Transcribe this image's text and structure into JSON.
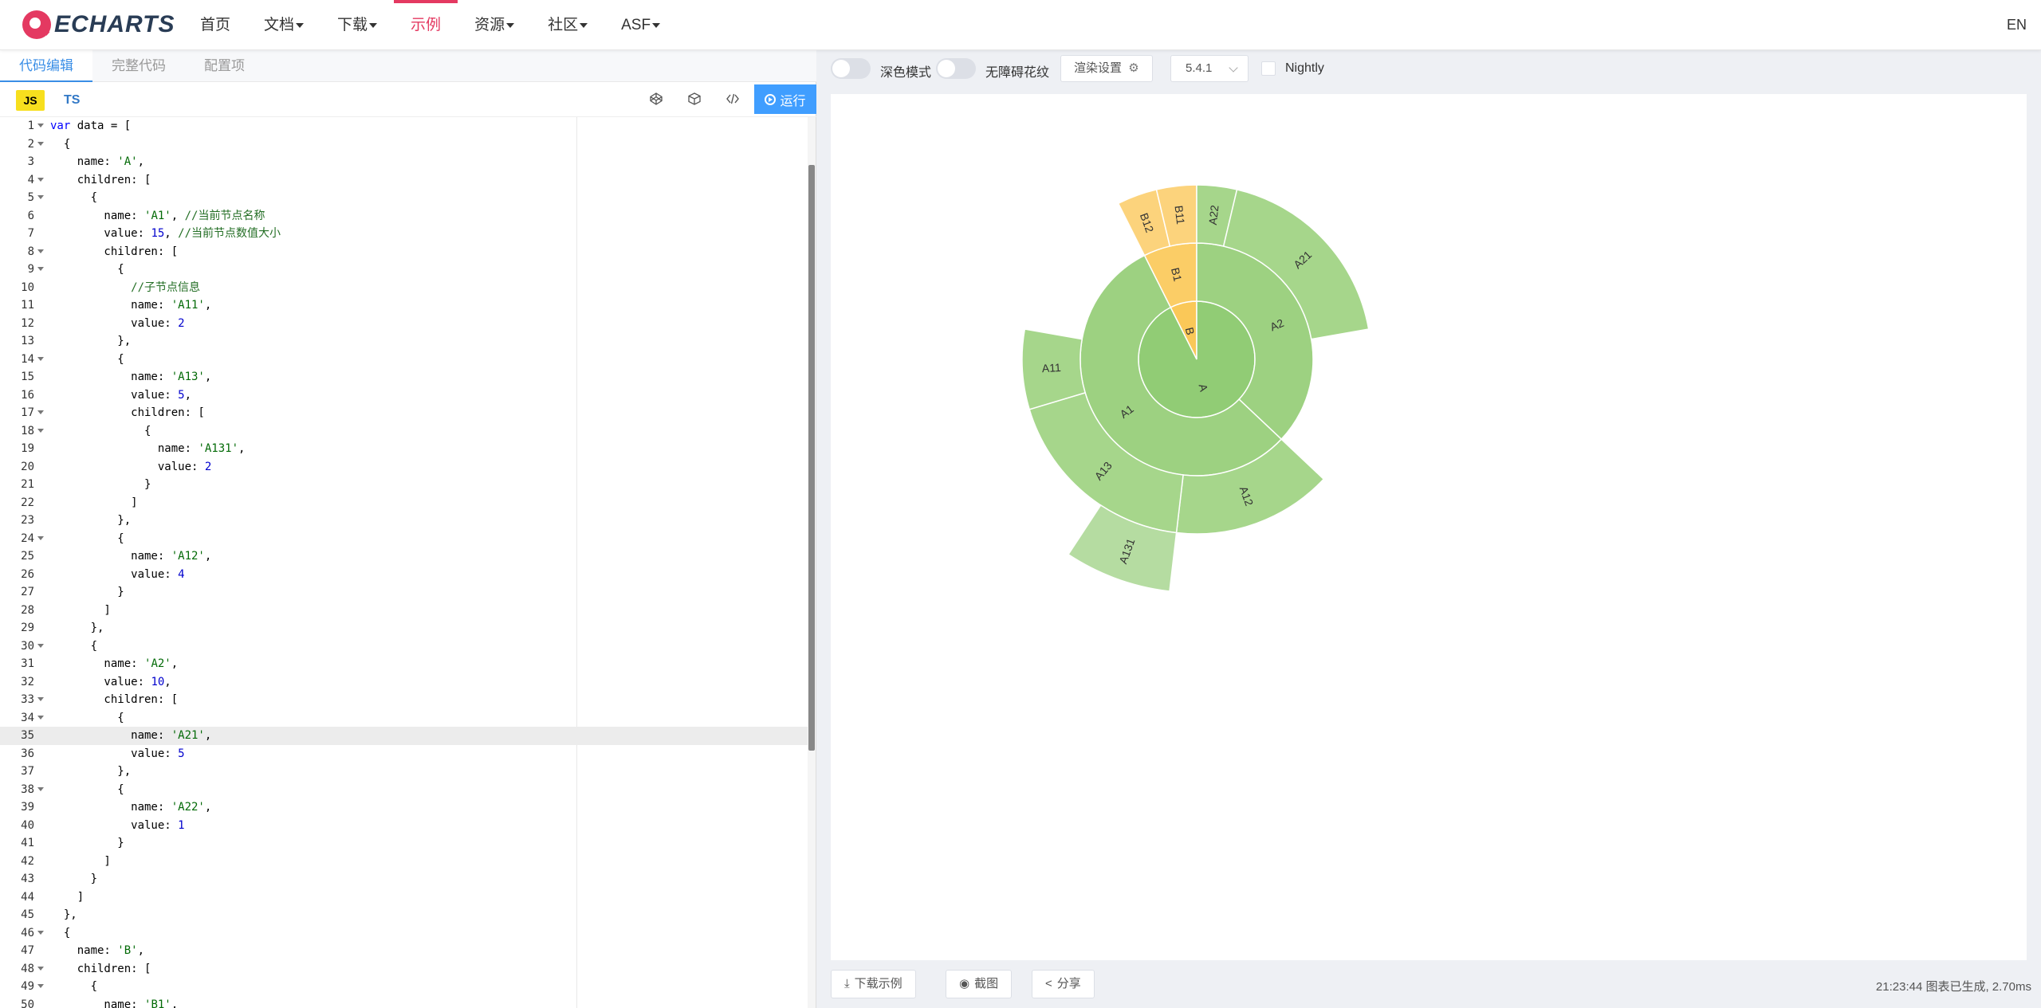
{
  "nav": {
    "logo_text": "ECHARTS",
    "links": [
      "首页",
      "文档",
      "下载",
      "示例",
      "资源",
      "社区",
      "ASF"
    ],
    "lang": "EN"
  },
  "editor_panel": {
    "tabs": [
      "代码编辑",
      "完整代码",
      "配置项"
    ],
    "js_label": "JS",
    "ts_label": "TS",
    "run_label": "运行"
  },
  "code_lines": [
    "var data = [",
    "  {",
    "    name: 'A',",
    "    children: [",
    "      {",
    "        name: 'A1', //当前节点名称",
    "        value: 15, //当前节点数值大小",
    "        children: [",
    "          {",
    "            //子节点信息",
    "            name: 'A11',",
    "            value: 2",
    "          },",
    "          {",
    "            name: 'A13',",
    "            value: 5,",
    "            children: [",
    "              {",
    "                name: 'A131',",
    "                value: 2",
    "              }",
    "            ]",
    "          },",
    "          {",
    "            name: 'A12',",
    "            value: 4",
    "          }",
    "        ]",
    "      },",
    "      {",
    "        name: 'A2',",
    "        value: 10,",
    "        children: [",
    "          {",
    "            name: 'A21',",
    "            value: 5",
    "          },",
    "          {",
    "            name: 'A22',",
    "            value: 1",
    "          }",
    "        ]",
    "      }",
    "    ]",
    "  },",
    "  {",
    "    name: 'B',",
    "    children: [",
    "      {",
    "        name: 'B1',"
  ],
  "controls": {
    "dark_mode": "深色模式",
    "decal": "无障碍花纹",
    "render_settings": "渲染设置",
    "version": "5.4.1",
    "nightly": "Nightly"
  },
  "bottom": {
    "download": "下载示例",
    "screenshot": "截图",
    "share": "分享",
    "status": "21:23:44   图表已生成, 2.70ms"
  },
  "colors": {
    "green": "#91cc75",
    "yellow": "#fac858",
    "accent": "#e43961",
    "run": "#409eff"
  },
  "chart_data": {
    "type": "sunburst",
    "nodes": [
      {
        "name": "A",
        "level": 1,
        "value": 25
      },
      {
        "name": "B",
        "level": 1,
        "value": 2
      },
      {
        "name": "A1",
        "level": 2,
        "value": 15,
        "parent": "A"
      },
      {
        "name": "A2",
        "level": 2,
        "value": 10,
        "parent": "A"
      },
      {
        "name": "B1",
        "level": 2,
        "value": 2,
        "parent": "B"
      },
      {
        "name": "A11",
        "level": 3,
        "value": 2,
        "parent": "A1"
      },
      {
        "name": "A13",
        "level": 3,
        "value": 5,
        "parent": "A1"
      },
      {
        "name": "A12",
        "level": 3,
        "value": 4,
        "parent": "A1"
      },
      {
        "name": "A21",
        "level": 3,
        "value": 5,
        "parent": "A2"
      },
      {
        "name": "A22",
        "level": 3,
        "value": 1,
        "parent": "A2"
      },
      {
        "name": "B11",
        "level": 3,
        "value": 1,
        "parent": "B1"
      },
      {
        "name": "B12",
        "level": 3,
        "value": 1,
        "parent": "B1"
      },
      {
        "name": "A131",
        "level": 4,
        "value": 2,
        "parent": "A13"
      }
    ]
  }
}
